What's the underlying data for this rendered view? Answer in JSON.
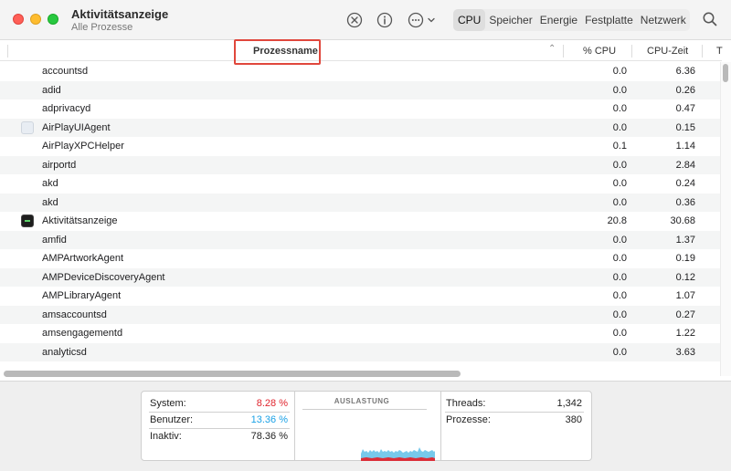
{
  "window": {
    "title": "Aktivitätsanzeige",
    "subtitle": "Alle Prozesse"
  },
  "toolbar": {
    "stop_icon": "x-circle-icon",
    "info_icon": "info-icon",
    "more_icon": "ellipsis-circle-icon",
    "search_icon": "magnifier-icon"
  },
  "tabs": [
    {
      "label": "CPU",
      "active": true
    },
    {
      "label": "Speicher",
      "active": false
    },
    {
      "label": "Energie",
      "active": false
    },
    {
      "label": "Festplatte",
      "active": false
    },
    {
      "label": "Netzwerk",
      "active": false
    }
  ],
  "table": {
    "columns": {
      "name": "Prozessname",
      "cpu": "% CPU",
      "time": "CPU-Zeit",
      "extra": "T"
    },
    "rows": [
      {
        "name": "accountsd",
        "cpu": "0.0",
        "time": "6.36",
        "icon": ""
      },
      {
        "name": "adid",
        "cpu": "0.0",
        "time": "0.26",
        "icon": ""
      },
      {
        "name": "adprivacyd",
        "cpu": "0.0",
        "time": "0.47",
        "icon": ""
      },
      {
        "name": "AirPlayUIAgent",
        "cpu": "0.0",
        "time": "0.15",
        "icon": "generic"
      },
      {
        "name": "AirPlayXPCHelper",
        "cpu": "0.1",
        "time": "1.14",
        "icon": ""
      },
      {
        "name": "airportd",
        "cpu": "0.0",
        "time": "2.84",
        "icon": ""
      },
      {
        "name": "akd",
        "cpu": "0.0",
        "time": "0.24",
        "icon": ""
      },
      {
        "name": "akd",
        "cpu": "0.0",
        "time": "0.36",
        "icon": ""
      },
      {
        "name": "Aktivitätsanzeige",
        "cpu": "20.8",
        "time": "30.68",
        "icon": "terminal"
      },
      {
        "name": "amfid",
        "cpu": "0.0",
        "time": "1.37",
        "icon": ""
      },
      {
        "name": "AMPArtworkAgent",
        "cpu": "0.0",
        "time": "0.19",
        "icon": ""
      },
      {
        "name": "AMPDeviceDiscoveryAgent",
        "cpu": "0.0",
        "time": "0.12",
        "icon": ""
      },
      {
        "name": "AMPLibraryAgent",
        "cpu": "0.0",
        "time": "1.07",
        "icon": ""
      },
      {
        "name": "amsaccountsd",
        "cpu": "0.0",
        "time": "0.27",
        "icon": ""
      },
      {
        "name": "amsengagementd",
        "cpu": "0.0",
        "time": "1.22",
        "icon": ""
      },
      {
        "name": "analyticsd",
        "cpu": "0.0",
        "time": "3.63",
        "icon": ""
      }
    ]
  },
  "summary": {
    "system_label": "System:",
    "system_value": "8.28 %",
    "user_label": "Benutzer:",
    "user_value": "13.36 %",
    "idle_label": "Inaktiv:",
    "idle_value": "78.36 %",
    "graph_title": "AUSLASTUNG",
    "threads_label": "Threads:",
    "threads_value": "1,342",
    "processes_label": "Prozesse:",
    "processes_value": "380"
  },
  "colors": {
    "system": "#e0252e",
    "user": "#1aa1e6",
    "highlight": "#e0473c"
  }
}
